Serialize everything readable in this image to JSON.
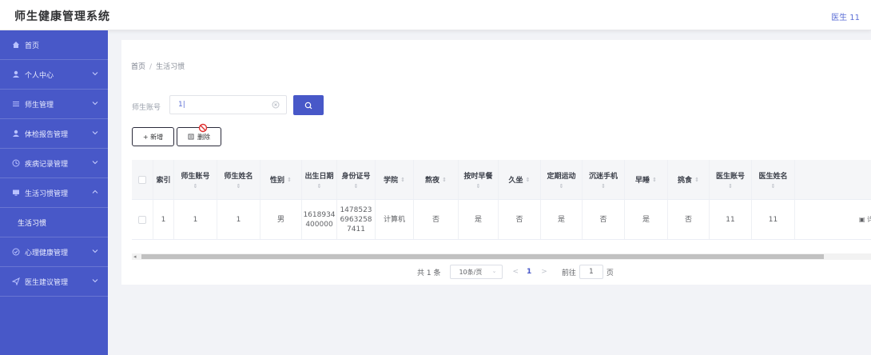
{
  "header": {
    "app_title": "师生健康管理系统",
    "user_label": "医生 11"
  },
  "sidebar": {
    "items": [
      {
        "label": "首页",
        "icon": "home-icon"
      },
      {
        "label": "个人中心",
        "icon": "user-icon"
      },
      {
        "label": "师生管理",
        "icon": "list-icon"
      },
      {
        "label": "体检报告管理",
        "icon": "user-icon"
      },
      {
        "label": "疾病记录管理",
        "icon": "clock-icon"
      },
      {
        "label": "生活习惯管理",
        "icon": "monitor-icon"
      },
      {
        "label": "生活习惯"
      },
      {
        "label": "心理健康管理",
        "icon": "check-circle-icon"
      },
      {
        "label": "医生建议管理",
        "icon": "send-icon"
      }
    ]
  },
  "breadcrumb": {
    "home": "首页",
    "separator": "/",
    "current": "生活习惯"
  },
  "search": {
    "label": "师生账号",
    "value": "1|"
  },
  "toolbar": {
    "add_label": "+ 新增",
    "delete_label": "删除"
  },
  "table": {
    "columns": [
      "索引",
      "师生账号",
      "师生姓名",
      "性别",
      "出生日期",
      "身份证号",
      "学院",
      "熬夜",
      "按时早餐",
      "久坐",
      "定期运动",
      "沉迷手机",
      "早睡",
      "挑食",
      "医生账号",
      "医生姓名"
    ],
    "rows": [
      {
        "index": "1",
        "account": "1",
        "name": "1",
        "gender": "男",
        "birth_line1": "1618934",
        "birth_line2": "400000",
        "id_line1": "1478523",
        "id_line2": "6963258",
        "id_line3": "7411",
        "college": "计算机",
        "stay_up": "否",
        "breakfast": "是",
        "sedentary": "否",
        "exercise": "是",
        "phone": "否",
        "sleep_early": "是",
        "picky": "否",
        "doctor_account": "11",
        "doctor_name": "11",
        "action": "详"
      }
    ]
  },
  "pagination": {
    "total": "共 1 条",
    "page_size": "10条/页",
    "prev": "<",
    "current_page": "1",
    "next": ">",
    "goto_prefix": "前往",
    "goto_value": "1",
    "goto_suffix": "页"
  },
  "colors": {
    "primary": "#4858c8",
    "background": "#f2f3f7"
  }
}
